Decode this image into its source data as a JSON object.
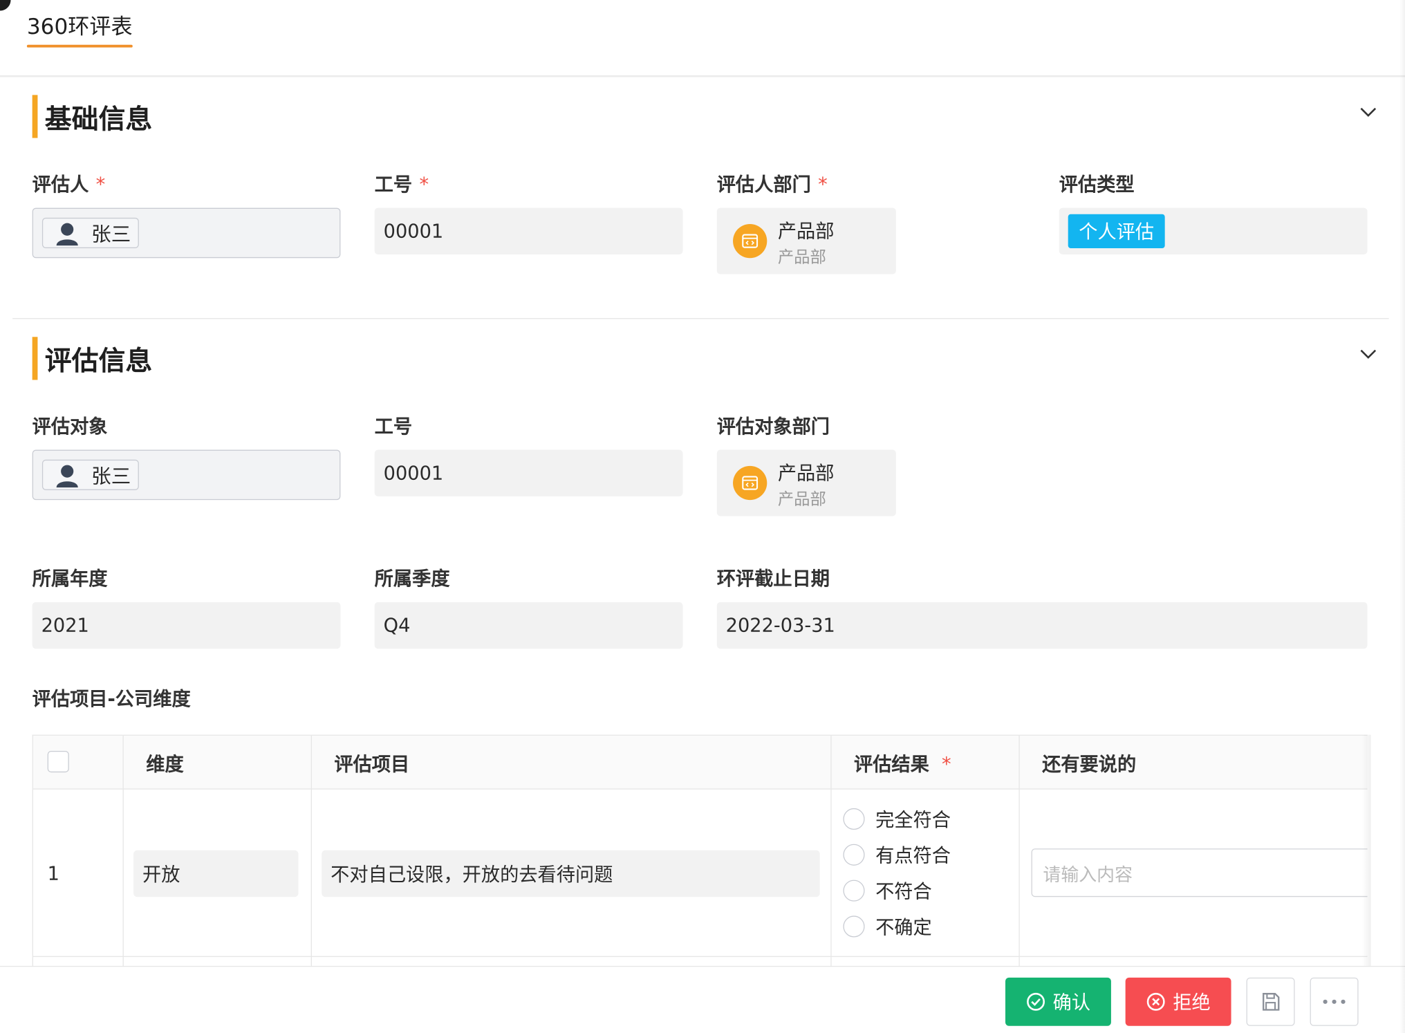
{
  "tab": {
    "label": "360环评表"
  },
  "basic": {
    "title": "基础信息",
    "evaluator_label": "评估人",
    "evaluator_name": "张三",
    "jobno_label": "工号",
    "jobno_value": "00001",
    "dept_label": "评估人部门",
    "dept_name": "产品部",
    "dept_sub": "产品部",
    "type_label": "评估类型",
    "type_value": "个人评估",
    "required_mark": "*"
  },
  "evaluation": {
    "title": "评估信息",
    "target_label": "评估对象",
    "target_name": "张三",
    "jobno_label": "工号",
    "jobno_value": "00001",
    "dept_label": "评估对象部门",
    "dept_name": "产品部",
    "dept_sub": "产品部",
    "year_label": "所属年度",
    "year_value": "2021",
    "quarter_label": "所属季度",
    "quarter_value": "Q4",
    "deadline_label": "环评截止日期",
    "deadline_value": "2022-03-31"
  },
  "items_table": {
    "title": "评估项目-公司维度",
    "headers": [
      "维度",
      "评估项目",
      "评估结果",
      "还有要说的"
    ],
    "required_mark": "*",
    "rows": [
      {
        "index": "1",
        "dimension": "开放",
        "item": "不对自己设限，开放的去看待问题",
        "options": [
          "完全符合",
          "有点符合",
          "不符合",
          "不确定"
        ],
        "comment_placeholder": "请输入内容"
      }
    ]
  },
  "footer": {
    "confirm_label": "确认",
    "reject_label": "拒绝",
    "save_icon": "save-icon",
    "more_icon": "more-icon"
  },
  "colors": {
    "accent": "#f5a623",
    "confirm": "#15b371",
    "reject": "#f64d51",
    "type_tag": "#13b5f0",
    "required": "#f04f43"
  }
}
